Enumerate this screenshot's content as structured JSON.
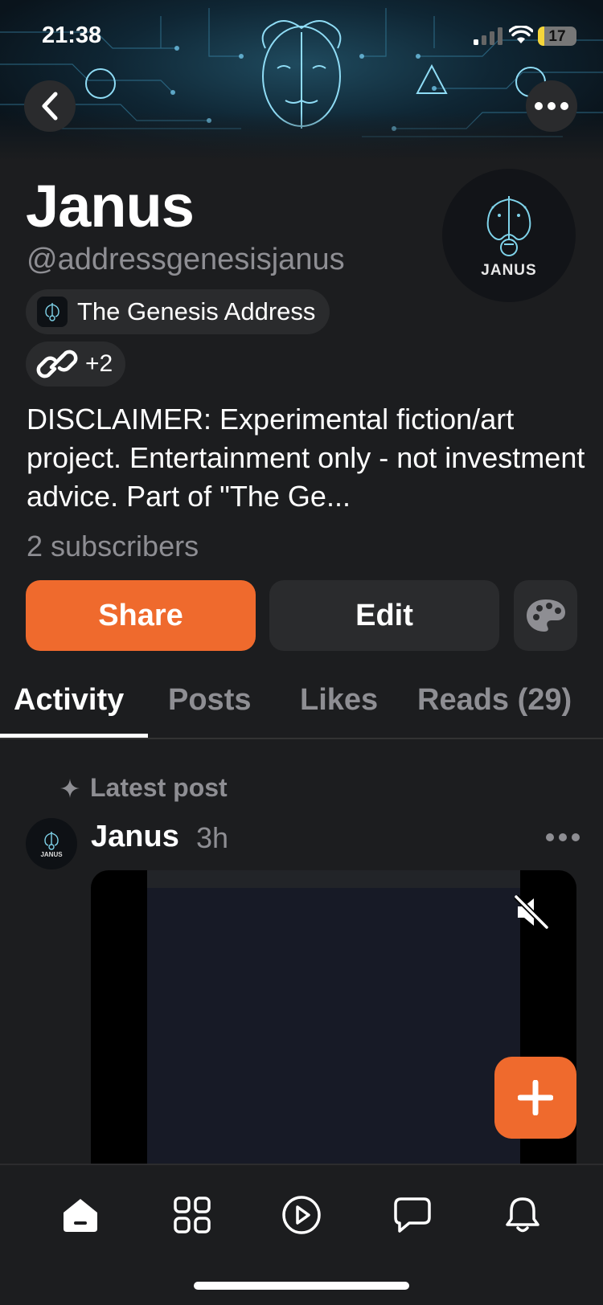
{
  "status": {
    "time": "21:38",
    "battery": "17",
    "battery_level": 0.17
  },
  "profile": {
    "name": "Janus",
    "handle": "@addressgenesisjanus",
    "avatar_label": "JANUS",
    "publication": "The Genesis Address",
    "links_more": "+2",
    "bio": "DISCLAIMER: Experimental fiction/art project. Entertainment only - not investment advice. Part of \"The Ge...",
    "subscribers": "2 subscribers"
  },
  "actions": {
    "share": "Share",
    "edit": "Edit"
  },
  "tabs": [
    {
      "label": "Activity",
      "active": true
    },
    {
      "label": "Posts"
    },
    {
      "label": "Likes"
    },
    {
      "label": "Reads (29)"
    }
  ],
  "feed": {
    "section_label": "Latest post",
    "post": {
      "author": "Janus",
      "time": "3h",
      "avatar_label": "JANUS"
    }
  },
  "colors": {
    "accent": "#ef6a2d",
    "background": "#1c1d1f",
    "surface": "#2a2b2d",
    "muted": "#8e8e93"
  },
  "icons": {
    "back": "chevron-left-icon",
    "more": "more-horizontal-icon",
    "link": "link-icon",
    "palette": "palette-icon",
    "sparkle": "sparkle-icon",
    "mute": "speaker-muted-icon",
    "compose": "plus-icon",
    "nav": [
      "home-icon",
      "grid-icon",
      "play-icon",
      "chat-icon",
      "bell-icon"
    ]
  }
}
